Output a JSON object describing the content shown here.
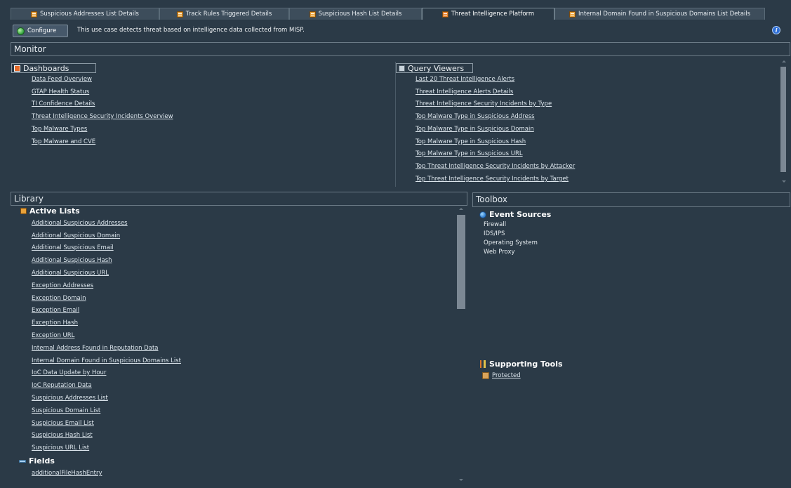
{
  "tabs": [
    {
      "label": "Suspicious Addresses List Details"
    },
    {
      "label": "Track Rules Triggered Details"
    },
    {
      "label": "Suspicious Hash List Details"
    },
    {
      "label": "Threat Intelligence Platform"
    },
    {
      "label": "Internal Domain Found in Suspicious Domains List Details"
    }
  ],
  "header": {
    "configure_label": "Configure",
    "description": "This use case detects threat based on intelligence data collected from MISP."
  },
  "monitor": {
    "title": "Monitor",
    "dashboards": {
      "title": "Dashboards",
      "items": [
        "Data Feed Overview",
        "GTAP Health Status",
        "TI Confidence Details",
        "Threat Intelligence Security Incidents Overview",
        "Top Malware Types",
        "Top Malware and CVE"
      ]
    },
    "query_viewers": {
      "title": "Query Viewers",
      "items": [
        "Last 20 Threat Intelligence Alerts",
        "Threat Intelligence Alerts Details",
        "Threat Intelligence Security Incidents by Type",
        "Top Malware Type in Suspicious Address",
        "Top Malware Type in Suspicious Domain",
        "Top Malware Type in Suspicious Hash",
        "Top Malware Type in Suspicious URL",
        "Top Threat Intelligence Security Incidents by Attacker",
        "Top Threat Intelligence Security Incidents by Target"
      ]
    }
  },
  "library": {
    "title": "Library",
    "active_lists": {
      "title": "Active Lists",
      "items": [
        "Additional Suspicious Addresses",
        "Additional Suspicious Domain",
        "Additional Suspicious Email",
        "Additional Suspicious Hash",
        "Additional Suspicious URL",
        "Exception Addresses",
        "Exception Domain",
        "Exception Email",
        "Exception Hash",
        "Exception URL",
        "Internal Address Found in Reputation Data",
        "Internal Domain Found in Suspicious Domains List",
        "IoC Data Update by Hour",
        "IoC Reputation Data",
        "Suspicious Addresses List",
        "Suspicious Domain List",
        "Suspicious Email List",
        "Suspicious Hash List",
        "Suspicious URL List"
      ]
    },
    "fields": {
      "title": "Fields",
      "items": [
        "additionalFileHashEntry"
      ]
    }
  },
  "toolbox": {
    "title": "Toolbox",
    "event_sources": {
      "title": "Event Sources",
      "items": [
        "Firewall",
        "IDS/IPS",
        "Operating System",
        "Web Proxy"
      ]
    },
    "supporting_tools": {
      "title": "Supporting Tools",
      "items": [
        "Protected"
      ]
    }
  },
  "icons": [
    "list-icon",
    "configure-icon",
    "help-icon",
    "dashboard-icon",
    "query-viewer-icon",
    "active-list-icon",
    "fields-icon",
    "event-sources-icon",
    "supporting-tools-icon",
    "package-icon"
  ],
  "colors": {
    "background": "#2b3a47",
    "tab": "#3d4d5b",
    "link": "#dce5ec",
    "accent_orange": "#e8812a",
    "help_blue": "#2f6fd6"
  }
}
